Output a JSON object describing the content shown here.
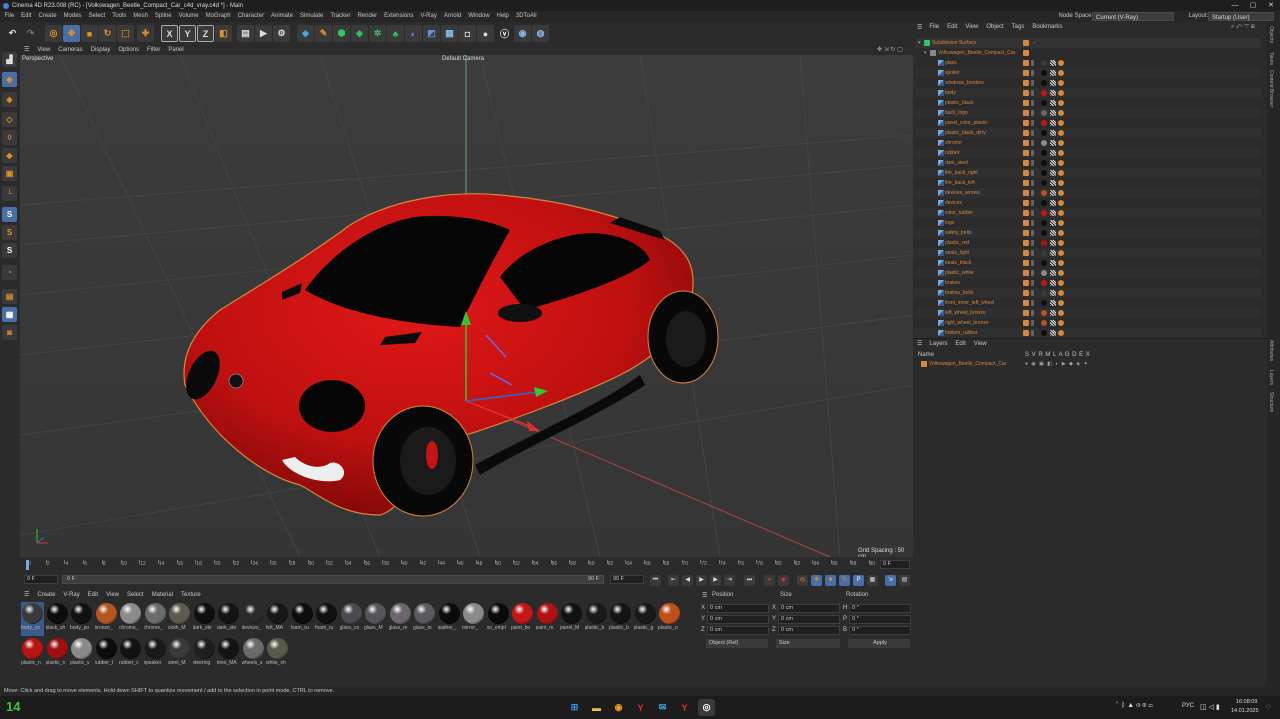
{
  "window": {
    "title": "Cinema 4D R23.008 (RC) - [Volkswagen_Beetle_Compact_Car_c4d_vray.c4d *] - Main"
  },
  "menu": {
    "items": [
      "File",
      "Edit",
      "Create",
      "Modes",
      "Select",
      "Tools",
      "Mesh",
      "Spline",
      "Volume",
      "MoGraph",
      "Character",
      "Animate",
      "Simulate",
      "Tracker",
      "Render",
      "Extensions",
      "V-Ray",
      "Arnold",
      "Window",
      "Help",
      "3DToAll"
    ],
    "node_space_label": "Node Space:",
    "node_space_value": "Current (V-Ray)",
    "layout_label": "Layout:",
    "layout_value": "Startup (User)"
  },
  "viewport": {
    "menu": [
      "View",
      "Cameras",
      "Display",
      "Options",
      "Filter",
      "Panel"
    ],
    "name": "Perspective",
    "camera": "Default Camera",
    "grid_spacing": "Grid Spacing : 50 cm"
  },
  "timeline": {
    "ticks": [
      "0",
      "2",
      "4",
      "6",
      "8",
      "10",
      "12",
      "14",
      "16",
      "18",
      "20",
      "22",
      "24",
      "26",
      "28",
      "30",
      "32",
      "34",
      "36",
      "38",
      "40",
      "42",
      "44",
      "46",
      "48",
      "50",
      "52",
      "54",
      "56",
      "58",
      "60",
      "62",
      "64",
      "66",
      "68",
      "70",
      "72",
      "74",
      "76",
      "78",
      "80",
      "82",
      "84",
      "86",
      "88",
      "90"
    ],
    "current_frame": "0 F",
    "start": "0 F",
    "range_start": "0 F",
    "range_end": "90 F",
    "end": "90 F"
  },
  "materials": {
    "menu": [
      "Create",
      "V-Ray",
      "Edit",
      "View",
      "Select",
      "Material",
      "Texture"
    ],
    "items": [
      {
        "name": "body_co",
        "color": "#3a3a3a",
        "selected": true
      },
      {
        "name": "black_sh",
        "color": "#0d0d0d"
      },
      {
        "name": "body_po",
        "color": "#111111"
      },
      {
        "name": "bronze_",
        "color": "#b3561f"
      },
      {
        "name": "chrome_",
        "color": "#8c8c8c"
      },
      {
        "name": "chrome_",
        "color": "#6a6a6a"
      },
      {
        "name": "cloth_M",
        "color": "#5f5a50"
      },
      {
        "name": "dark_ste",
        "color": "#0e0e0e"
      },
      {
        "name": "dark_ste",
        "color": "#141414"
      },
      {
        "name": "devices_",
        "color": "#2a2a2a"
      },
      {
        "name": "felt_MA",
        "color": "#161616"
      },
      {
        "name": "foam_ru",
        "color": "#0c0c0c"
      },
      {
        "name": "foam_ru",
        "color": "#101010"
      },
      {
        "name": "glass_co",
        "color": "#4a4a52"
      },
      {
        "name": "glass_M",
        "color": "#55555c"
      },
      {
        "name": "glass_re",
        "color": "#6e6470"
      },
      {
        "name": "glass_to",
        "color": "#5a5a60"
      },
      {
        "name": "leather_",
        "color": "#0b0b0b"
      },
      {
        "name": "mirror_",
        "color": "#8a8a8a"
      },
      {
        "name": "no_empl",
        "color": "#0a0a0a"
      },
      {
        "name": "paint_bo",
        "color": "#c41616"
      },
      {
        "name": "paint_re",
        "color": "#b01212"
      },
      {
        "name": "panel_M",
        "color": "#111111"
      },
      {
        "name": "plastic_b",
        "color": "#1a1a1a"
      },
      {
        "name": "plastic_b",
        "color": "#141414"
      },
      {
        "name": "plastic_g",
        "color": "#181818"
      },
      {
        "name": "plastic_o",
        "color": "#c0501a"
      },
      {
        "name": "plastic_n",
        "color": "#b81414"
      },
      {
        "name": "plastic_n",
        "color": "#9e1010"
      },
      {
        "name": "plastic_v",
        "color": "#8a8a8a"
      },
      {
        "name": "rubber_t",
        "color": "#0c0c0c"
      },
      {
        "name": "rubber_c",
        "color": "#121212"
      },
      {
        "name": "speaker",
        "color": "#1a1a1a"
      },
      {
        "name": "steel_M",
        "color": "#3a3a3a"
      },
      {
        "name": "steering",
        "color": "#1e1e1e"
      },
      {
        "name": "tires_MA",
        "color": "#141414"
      },
      {
        "name": "wheels_s",
        "color": "#6a6a6a"
      },
      {
        "name": "white_sh",
        "color": "#5a5a4a"
      }
    ]
  },
  "attributes": {
    "headers": [
      "Position",
      "Size",
      "Rotation"
    ],
    "rows": [
      {
        "axis": "X",
        "pos": "0 cm",
        "size_axis": "X",
        "size": "0 cm",
        "rot_axis": "H",
        "rot": "0 °"
      },
      {
        "axis": "Y",
        "pos": "0 cm",
        "size_axis": "Y",
        "size": "0 cm",
        "rot_axis": "P",
        "rot": "0 °"
      },
      {
        "axis": "Z",
        "pos": "0 cm",
        "size_axis": "Z",
        "size": "0 cm",
        "rot_axis": "B",
        "rot": "0 °"
      }
    ],
    "coord_mode": "Object (Rel)",
    "size_mode": "Size",
    "apply_label": "Apply"
  },
  "object_manager": {
    "menu": [
      "File",
      "Edit",
      "View",
      "Object",
      "Tags",
      "Bookmarks"
    ],
    "root": "Subdivision Surface",
    "group": "Volkswagen_Beetle_Compact_Car",
    "objects": [
      {
        "name": "glass",
        "mat": "#3a3a3a"
      },
      {
        "name": "spoiler",
        "mat": "#0d0d0d"
      },
      {
        "name": "windows_borders",
        "mat": "#0d0d0d"
      },
      {
        "name": "body",
        "mat": "#c41616"
      },
      {
        "name": "plastic_black",
        "mat": "#0d0d0d"
      },
      {
        "name": "back_logo",
        "mat": "#6a6a6a"
      },
      {
        "name": "panel_color_plastic",
        "mat": "#c41616"
      },
      {
        "name": "plastic_black_dirty",
        "mat": "#0d0d0d"
      },
      {
        "name": "chrome",
        "mat": "#8c8c8c"
      },
      {
        "name": "rubber",
        "mat": "#0d0d0d"
      },
      {
        "name": "dark_steel",
        "mat": "#0d0d0d"
      },
      {
        "name": "fire_back_right",
        "mat": "#0d0d0d"
      },
      {
        "name": "fire_back_left",
        "mat": "#0d0d0d"
      },
      {
        "name": "devices_arrows",
        "mat": "#c0501a"
      },
      {
        "name": "devices",
        "mat": "#0d0d0d"
      },
      {
        "name": "color_rubber",
        "mat": "#c41616"
      },
      {
        "name": "logo",
        "mat": "#0d0d0d"
      },
      {
        "name": "safety_belts",
        "mat": "#0d0d0d"
      },
      {
        "name": "plastic_red",
        "mat": "#b01212"
      },
      {
        "name": "seats_light",
        "mat": "#3a3a3a"
      },
      {
        "name": "seats_black",
        "mat": "#0d0d0d"
      },
      {
        "name": "plastic_white",
        "mat": "#8a8a8a"
      },
      {
        "name": "brakes",
        "mat": "#c41616"
      },
      {
        "name": "brakes_bolts",
        "mat": "#3a3a3a"
      },
      {
        "name": "front_inner_left_wheel",
        "mat": "#0d0d0d"
      },
      {
        "name": "left_wheel_bronze",
        "mat": "#b3561f"
      },
      {
        "name": "right_wheel_bronze",
        "mat": "#b3561f"
      },
      {
        "name": "bottom_rubber",
        "mat": "#0d0d0d"
      }
    ]
  },
  "layers": {
    "menu": [
      "Layers",
      "Edit",
      "View"
    ],
    "col_name": "Name",
    "col_flags": "S V R M L A G D E X",
    "items": [
      {
        "name": "Volkswagen_Beetle_Compact_Car",
        "color": "#d7873f"
      }
    ]
  },
  "right_tabs": [
    "Objects",
    "Takes",
    "Content Browser",
    "Attributes",
    "Layers",
    "Structure"
  ],
  "status": {
    "text": "Move: Click and drag to move elements. Hold down SHIFT to quantize movement / add to the selection in point mode, CTRL to remove."
  },
  "taskbar": {
    "widget": "14",
    "lang": "РУС",
    "time": "16:08:09",
    "date": "14.01.2025"
  },
  "colors": {
    "accent": "#d7873f",
    "selection": "#5b8fd3",
    "car_red": "#c41616"
  }
}
